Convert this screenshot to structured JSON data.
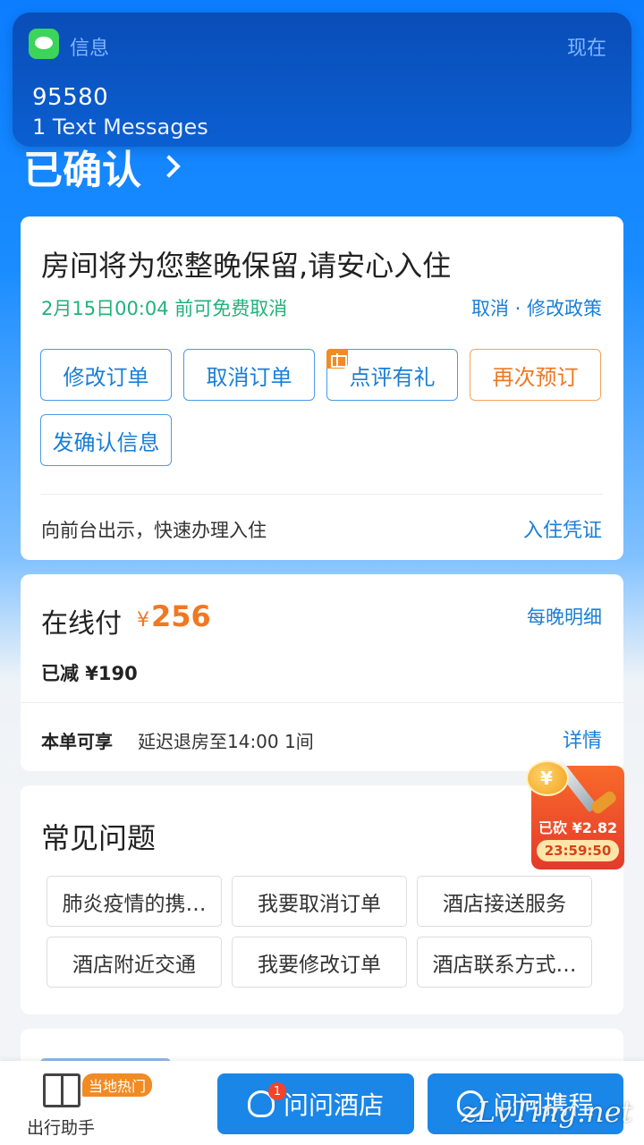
{
  "notification": {
    "app_name": "信息",
    "time": "现在",
    "sender": "95580",
    "body": "1 Text Messages"
  },
  "order": {
    "status": "已确认"
  },
  "reservation_card": {
    "title": "房间将为您整晚保留,请安心入住",
    "free_cancel": "2月15日00:04 前可免费取消",
    "policy_link": "取消 · 修改政策",
    "buttons": {
      "modify": "修改订单",
      "cancel": "取消订单",
      "review": "点评有礼",
      "rebook": "再次预订",
      "send_confirm": "发确认信息"
    },
    "checkin_hint": "向前台出示，快速办理入住",
    "voucher_link": "入住凭证"
  },
  "payment_card": {
    "label": "在线付",
    "currency": "¥",
    "amount": "256",
    "nightly_link": "每晚明细",
    "reduced": "已减 ¥190",
    "perk_label": "本单可享",
    "perk_text": "延迟退房至14:00 1间",
    "detail_link": "详情"
  },
  "faq_card": {
    "title": "常见问题",
    "items": [
      "肺炎疫情的携…",
      "我要取消订单",
      "酒店接送服务",
      "酒店附近交通",
      "我要修改订单",
      "酒店联系方式…"
    ]
  },
  "promo": {
    "cut_text": "已砍 ¥2.82",
    "timer": "23:59:50"
  },
  "bottom_bar": {
    "assistant_label": "出行助手",
    "hot_badge": "当地热门",
    "ask_hotel": "问问酒店",
    "ask_hotel_badge": "1",
    "ask_ctrip": "问问携程"
  },
  "watermark": "zLvTing.net",
  "colors": {
    "primary_blue": "#1b7ed6",
    "orange": "#f07822",
    "green": "#20b27a",
    "header_bg": "#0b7dff"
  }
}
